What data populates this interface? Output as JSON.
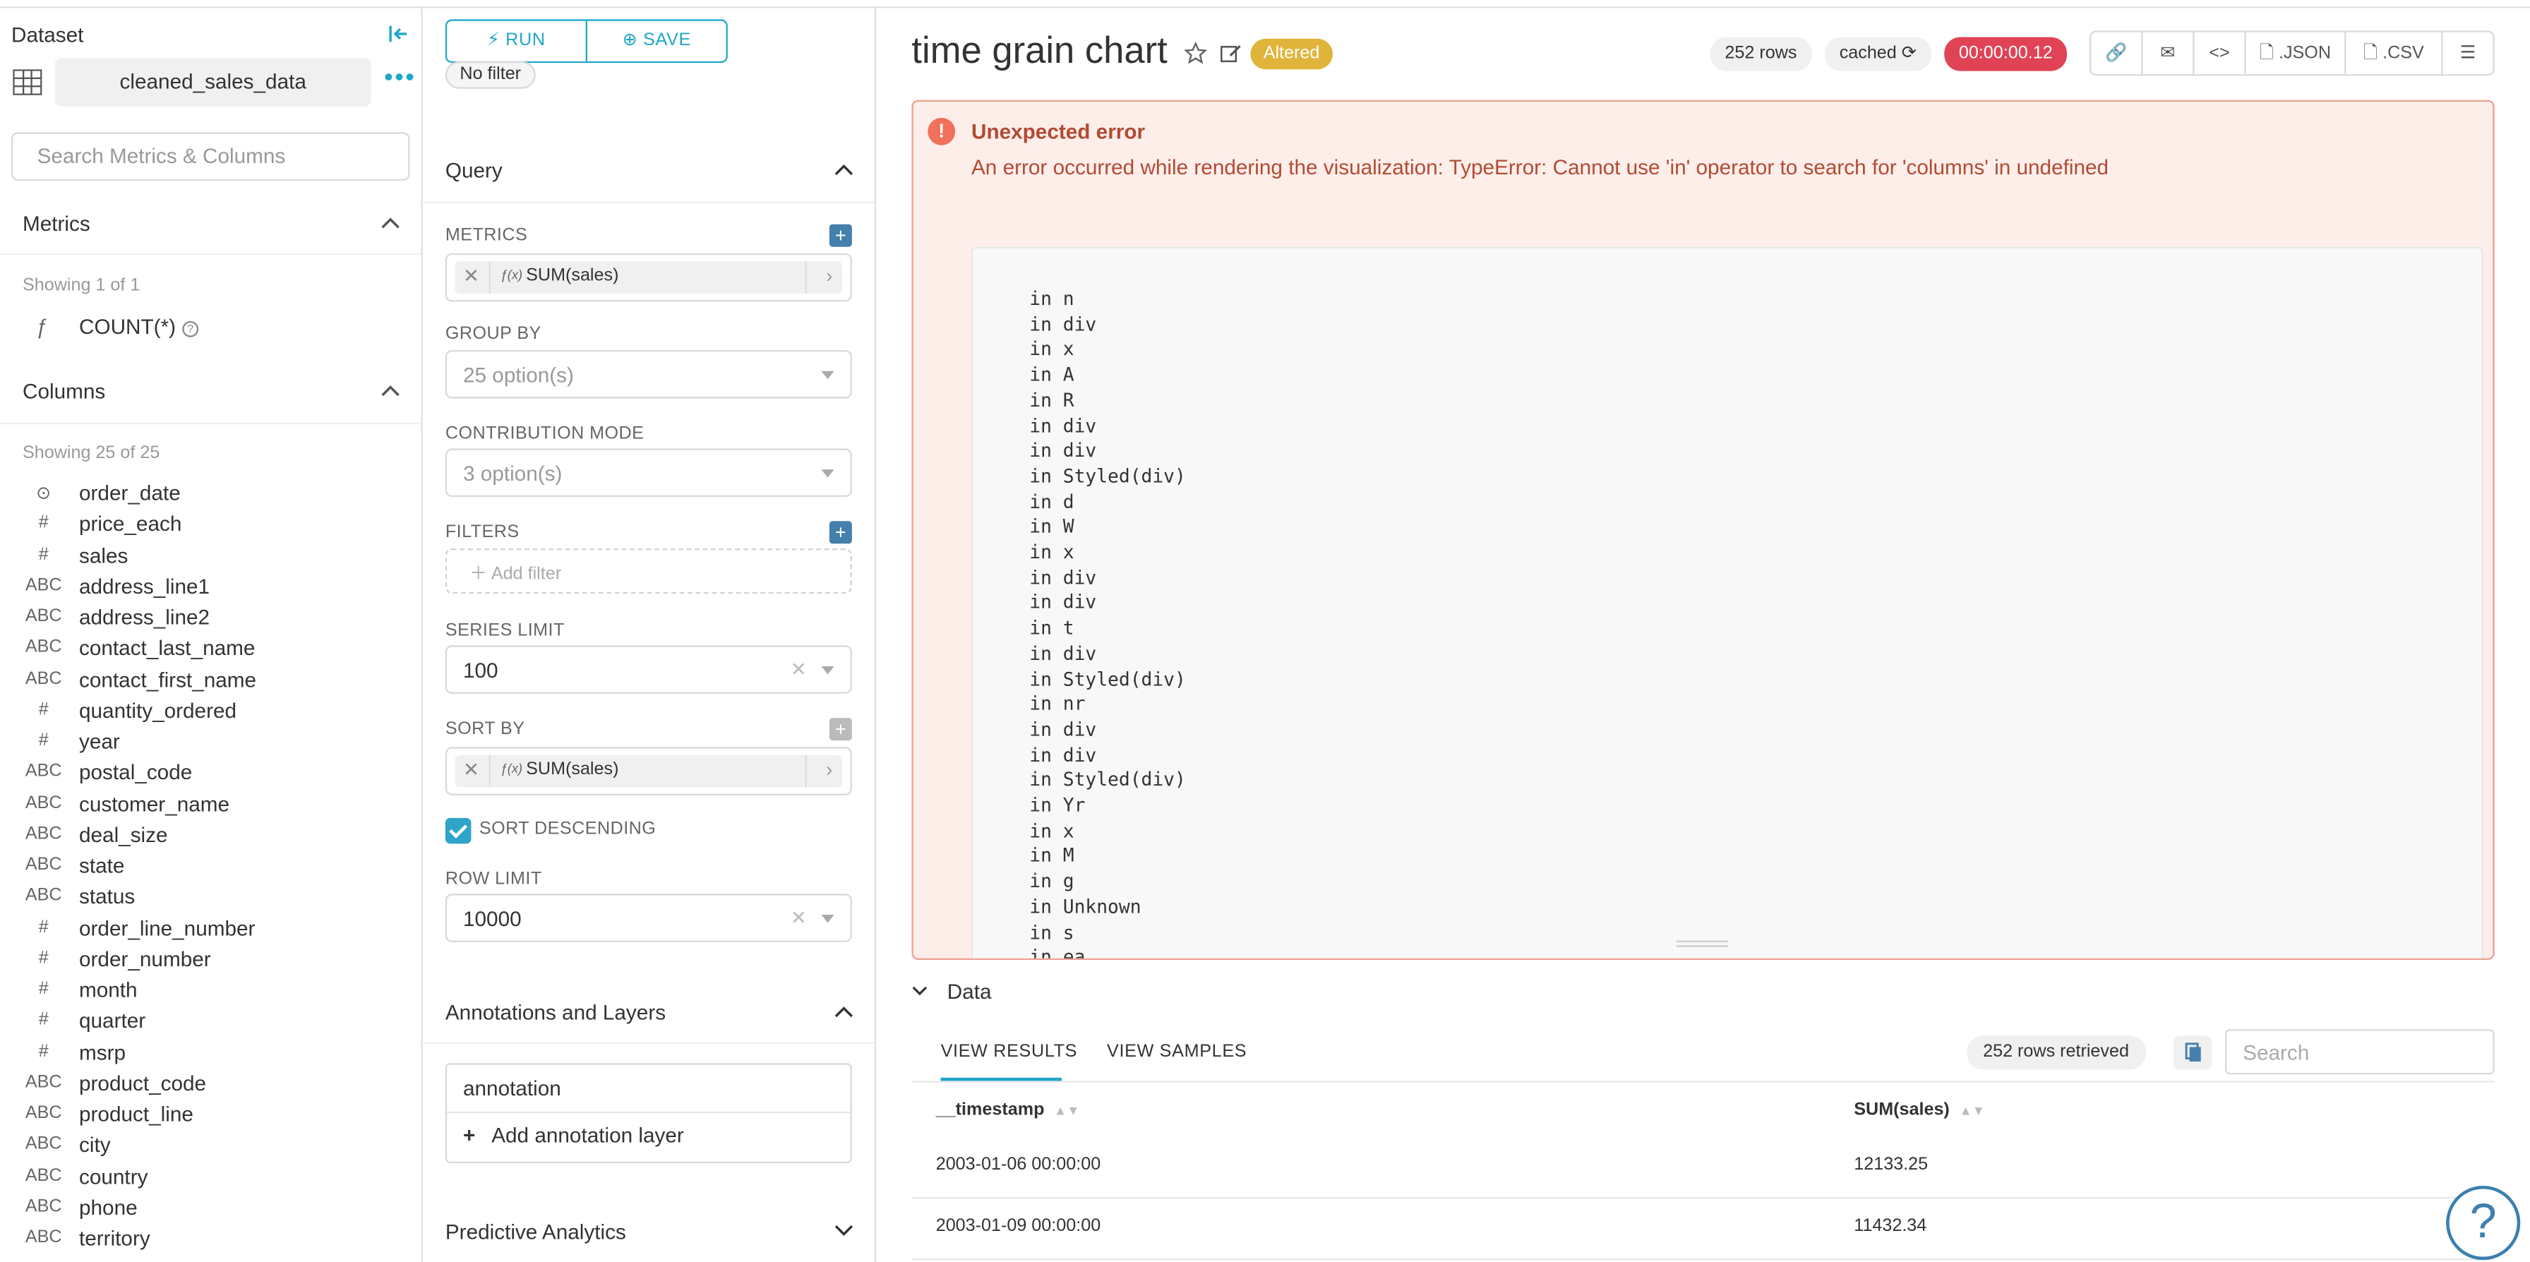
{
  "dataset_panel": {
    "title": "Dataset",
    "dataset_name": "cleaned_sales_data",
    "search_placeholder": "Search Metrics & Columns",
    "metrics_heading": "Metrics",
    "metrics_showing": "Showing 1 of 1",
    "metrics": [
      {
        "icon": "ƒ",
        "name": "COUNT(*)"
      }
    ],
    "columns_heading": "Columns",
    "columns_showing": "Showing 25 of 25",
    "columns": [
      {
        "type": "⊙",
        "name": "order_date"
      },
      {
        "type": "#",
        "name": "price_each"
      },
      {
        "type": "#",
        "name": "sales"
      },
      {
        "type": "ABC",
        "name": "address_line1"
      },
      {
        "type": "ABC",
        "name": "address_line2"
      },
      {
        "type": "ABC",
        "name": "contact_last_name"
      },
      {
        "type": "ABC",
        "name": "contact_first_name"
      },
      {
        "type": "#",
        "name": "quantity_ordered"
      },
      {
        "type": "#",
        "name": "year"
      },
      {
        "type": "ABC",
        "name": "postal_code"
      },
      {
        "type": "ABC",
        "name": "customer_name"
      },
      {
        "type": "ABC",
        "name": "deal_size"
      },
      {
        "type": "ABC",
        "name": "state"
      },
      {
        "type": "ABC",
        "name": "status"
      },
      {
        "type": "#",
        "name": "order_line_number"
      },
      {
        "type": "#",
        "name": "order_number"
      },
      {
        "type": "#",
        "name": "month"
      },
      {
        "type": "#",
        "name": "quarter"
      },
      {
        "type": "#",
        "name": "msrp"
      },
      {
        "type": "ABC",
        "name": "product_code"
      },
      {
        "type": "ABC",
        "name": "product_line"
      },
      {
        "type": "ABC",
        "name": "city"
      },
      {
        "type": "ABC",
        "name": "country"
      },
      {
        "type": "ABC",
        "name": "phone"
      },
      {
        "type": "ABC",
        "name": "territory"
      }
    ]
  },
  "controls": {
    "run_label": "RUN",
    "save_label": "SAVE",
    "no_filter": "No filter",
    "query_heading": "Query",
    "metrics_label": "METRICS",
    "metrics_value": "SUM(sales)",
    "groupby_label": "GROUP BY",
    "groupby_placeholder": "25 option(s)",
    "contribution_label": "CONTRIBUTION MODE",
    "contribution_placeholder": "3 option(s)",
    "filters_label": "FILTERS",
    "add_filter": "Add filter",
    "series_limit_label": "SERIES LIMIT",
    "series_limit_value": "100",
    "sort_by_label": "SORT BY",
    "sort_by_value": "SUM(sales)",
    "sort_desc_label": "SORT DESCENDING",
    "sort_desc_checked": true,
    "row_limit_label": "ROW LIMIT",
    "row_limit_value": "10000",
    "annotations_heading": "Annotations and Layers",
    "annotation_item": "annotation",
    "add_annotation": "Add annotation layer",
    "predictive_heading": "Predictive Analytics"
  },
  "chart": {
    "title": "time grain chart",
    "altered": "Altered",
    "rows": "252 rows",
    "cached": "cached",
    "timer": "00:00:00.12",
    "json_label": ".JSON",
    "csv_label": ".CSV",
    "error_title": "Unexpected error",
    "error_message": "An error occurred while rendering the visualization: TypeError: Cannot use 'in' operator to search for 'columns' in undefined",
    "stack_lines": [
      "in n",
      "in div",
      "in x",
      "in A",
      "in R",
      "in div",
      "in div",
      "in Styled(div)",
      "in d",
      "in W",
      "in x",
      "in div",
      "in div",
      "in t",
      "in div",
      "in Styled(div)",
      "in nr",
      "in div",
      "in div",
      "in Styled(div)",
      "in Yr",
      "in x",
      "in M",
      "in g",
      "in Unknown",
      "in s",
      "in ea"
    ]
  },
  "data_section": {
    "heading": "Data",
    "tab_results": "VIEW RESULTS",
    "tab_samples": "VIEW SAMPLES",
    "rows_retrieved": "252 rows retrieved",
    "search_placeholder": "Search",
    "columns": [
      "__timestamp",
      "SUM(sales)"
    ],
    "rows": [
      [
        "2003-01-06 00:00:00",
        "12133.25"
      ],
      [
        "2003-01-09 00:00:00",
        "11432.34"
      ]
    ]
  },
  "colors": {
    "accent": "#20a7c9",
    "error_bg": "#fdeeea",
    "error_text": "#b34a33",
    "altered": "#e0b43a",
    "timer": "#e04355"
  }
}
